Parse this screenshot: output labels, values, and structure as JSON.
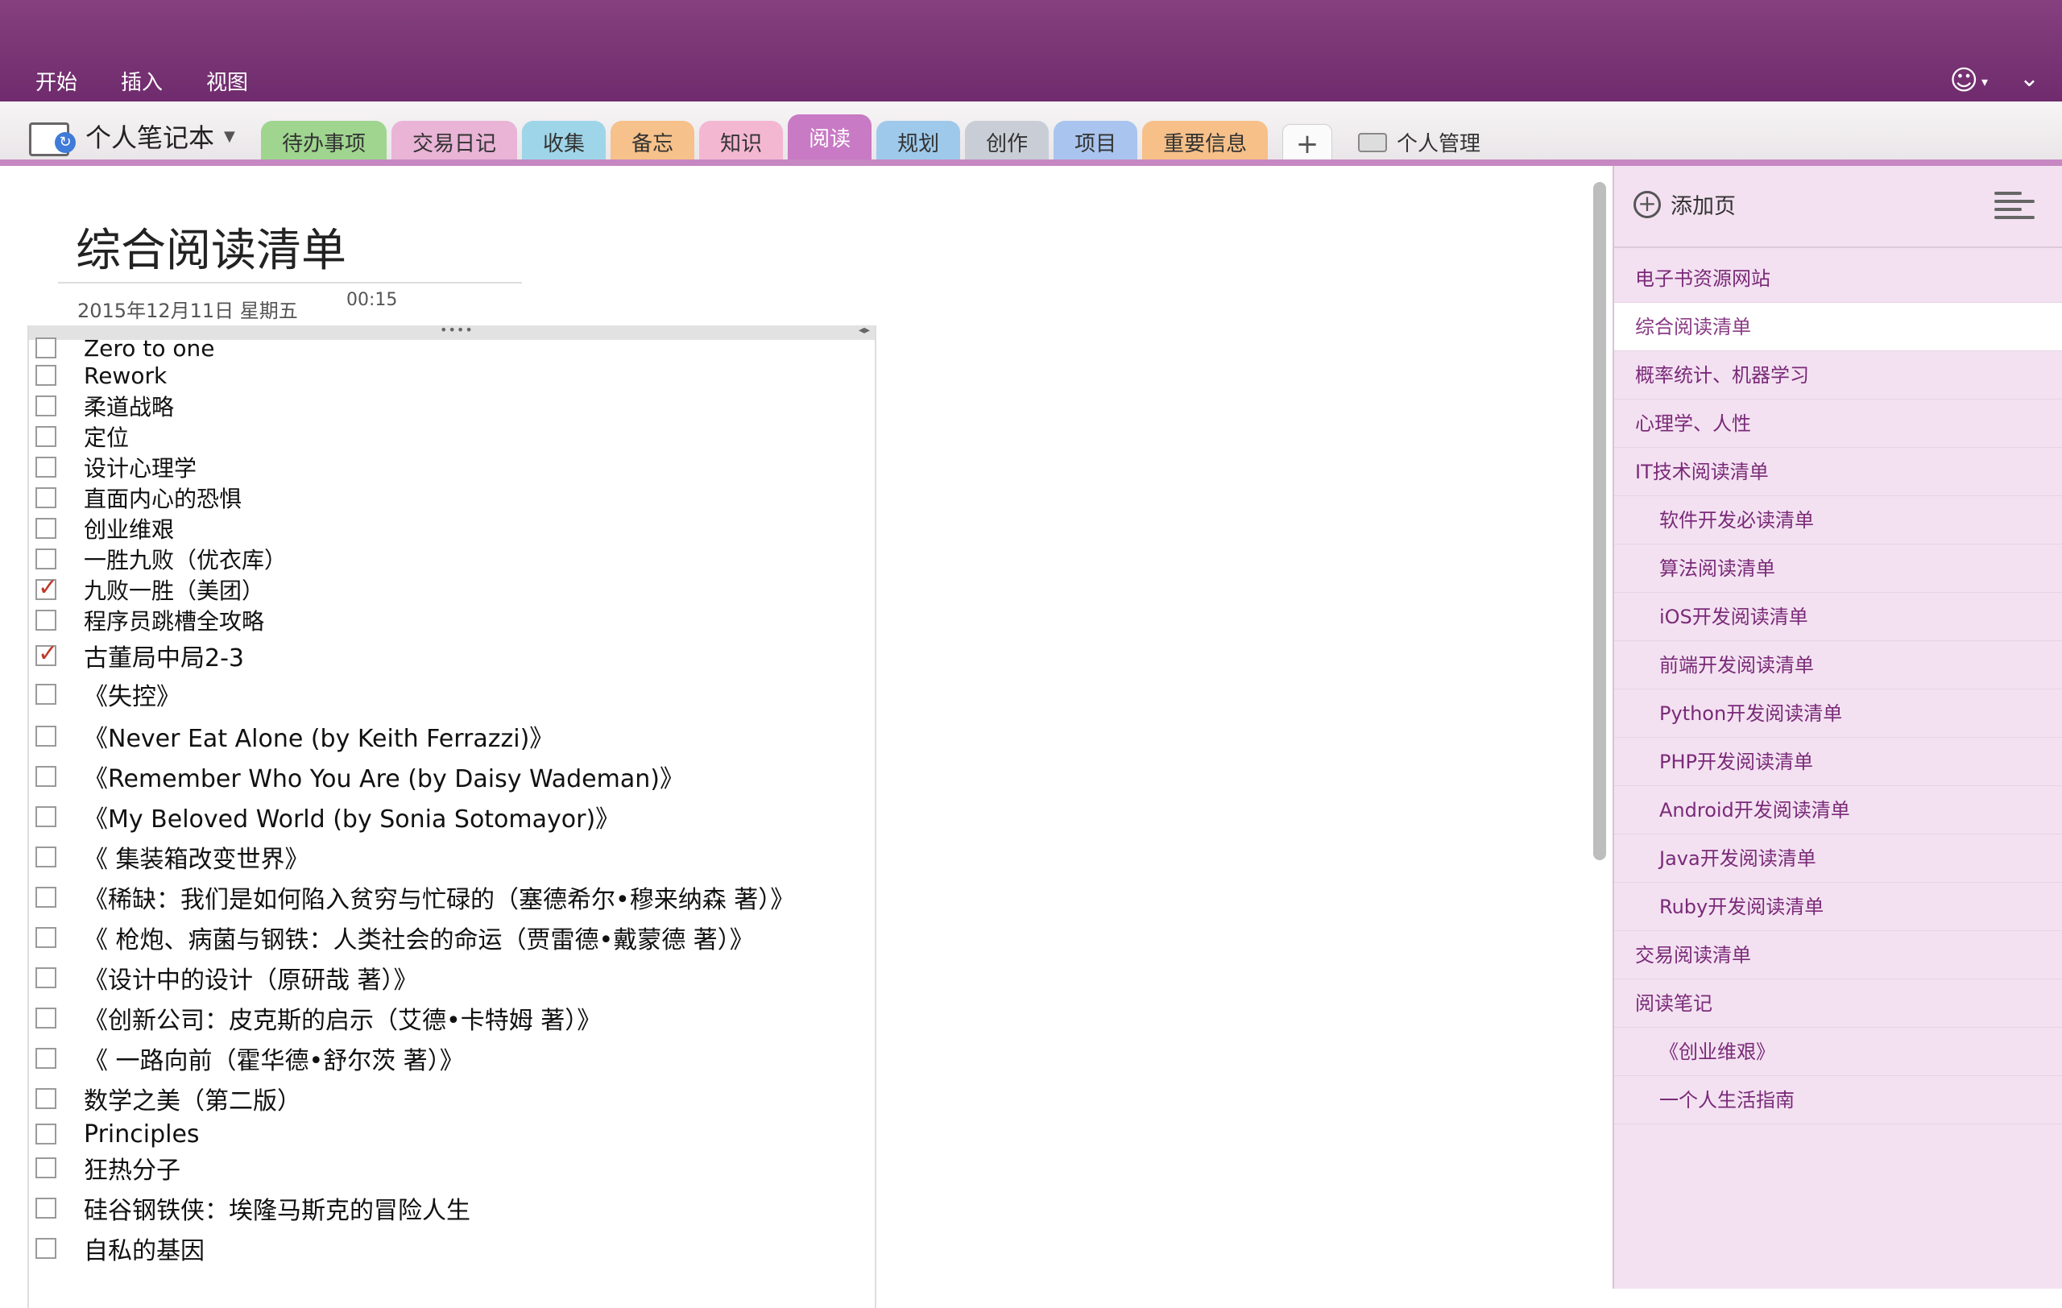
{
  "ribbon": {
    "menu": [
      "开始",
      "插入",
      "视图"
    ]
  },
  "notebook": {
    "title": "个人笔记本",
    "caret": "▼"
  },
  "sections": [
    {
      "label": "待办事项",
      "color": "#9fd58f",
      "active": false
    },
    {
      "label": "交易日记",
      "color": "#e9b4d6",
      "active": false
    },
    {
      "label": "收集",
      "color": "#9fd5e8",
      "active": false
    },
    {
      "label": "备忘",
      "color": "#f6c18a",
      "active": false
    },
    {
      "label": "知识",
      "color": "#f4b7d2",
      "active": false
    },
    {
      "label": "阅读",
      "color": "#c87ac4",
      "active": true
    },
    {
      "label": "规划",
      "color": "#9ec9ea",
      "active": false
    },
    {
      "label": "创作",
      "color": "#c9ced6",
      "active": false
    },
    {
      "label": "项目",
      "color": "#a9c4ee",
      "active": false
    },
    {
      "label": "重要信息",
      "color": "#f7c089",
      "active": false
    }
  ],
  "add_section": "+",
  "section_group": "个人管理",
  "page": {
    "title": "综合阅读清单",
    "date": "2015年12月11日 星期五",
    "time": "00:15"
  },
  "todos": [
    {
      "text": "Zero to one",
      "checked": false
    },
    {
      "text": "Rework",
      "checked": false
    },
    {
      "text": "柔道战略",
      "checked": false
    },
    {
      "text": "定位",
      "checked": false
    },
    {
      "text": "设计心理学",
      "checked": false
    },
    {
      "text": "直面内心的恐惧",
      "checked": false
    },
    {
      "text": "创业维艰",
      "checked": false
    },
    {
      "text": "一胜九败（优衣库）",
      "checked": false
    },
    {
      "text": "九败一胜（美团）",
      "checked": true
    },
    {
      "text": "程序员跳槽全攻略",
      "checked": false
    },
    {
      "text": "古董局中局2-3",
      "checked": true
    },
    {
      "text": "《失控》",
      "checked": false
    },
    {
      "text": "《Never Eat Alone (by Keith Ferrazzi)》",
      "checked": false
    },
    {
      "text": "《Remember Who You Are (by Daisy Wademan)》",
      "checked": false
    },
    {
      "text": "《My Beloved World (by Sonia Sotomayor)》",
      "checked": false
    },
    {
      "text": "《 集装箱改变世界》",
      "checked": false
    },
    {
      "text": "《稀缺：我们是如何陷入贫穷与忙碌的（塞德希尔•穆来纳森 著）》",
      "checked": false
    },
    {
      "text": "《 枪炮、病菌与钢铁：人类社会的命运（贾雷德•戴蒙德 著）》",
      "checked": false
    },
    {
      "text": "《设计中的设计（原研哉 著）》",
      "checked": false
    },
    {
      "text": "《创新公司：皮克斯的启示（艾德•卡特姆 著）》",
      "checked": false
    },
    {
      "text": "《 一路向前（霍华德•舒尔茨 著）》",
      "checked": false
    },
    {
      "text": "数学之美（第二版）",
      "checked": false
    },
    {
      "text": "Principles",
      "checked": false
    },
    {
      "text": "狂热分子",
      "checked": false
    },
    {
      "text": "硅谷钢铁侠：埃隆马斯克的冒险人生",
      "checked": false
    },
    {
      "text": "自私的基因",
      "checked": false
    }
  ],
  "pane": {
    "add_page": "添加页",
    "pages": [
      {
        "label": "电子书资源网站",
        "level": 1,
        "selected": false
      },
      {
        "label": "综合阅读清单",
        "level": 1,
        "selected": true
      },
      {
        "label": "概率统计、机器学习",
        "level": 1,
        "selected": false
      },
      {
        "label": "心理学、人性",
        "level": 1,
        "selected": false
      },
      {
        "label": "IT技术阅读清单",
        "level": 1,
        "selected": false
      },
      {
        "label": "软件开发必读清单",
        "level": 2,
        "selected": false
      },
      {
        "label": "算法阅读清单",
        "level": 2,
        "selected": false
      },
      {
        "label": "iOS开发阅读清单",
        "level": 2,
        "selected": false
      },
      {
        "label": "前端开发阅读清单",
        "level": 2,
        "selected": false
      },
      {
        "label": "Python开发阅读清单",
        "level": 2,
        "selected": false
      },
      {
        "label": "PHP开发阅读清单",
        "level": 2,
        "selected": false
      },
      {
        "label": "Android开发阅读清单",
        "level": 2,
        "selected": false
      },
      {
        "label": "Java开发阅读清单",
        "level": 2,
        "selected": false
      },
      {
        "label": "Ruby开发阅读清单",
        "level": 2,
        "selected": false
      },
      {
        "label": "交易阅读清单",
        "level": 1,
        "selected": false
      },
      {
        "label": "阅读笔记",
        "level": 1,
        "selected": false
      },
      {
        "label": "《创业维艰》",
        "level": 2,
        "selected": false
      },
      {
        "label": "一个人生活指南",
        "level": 2,
        "selected": false
      }
    ]
  }
}
